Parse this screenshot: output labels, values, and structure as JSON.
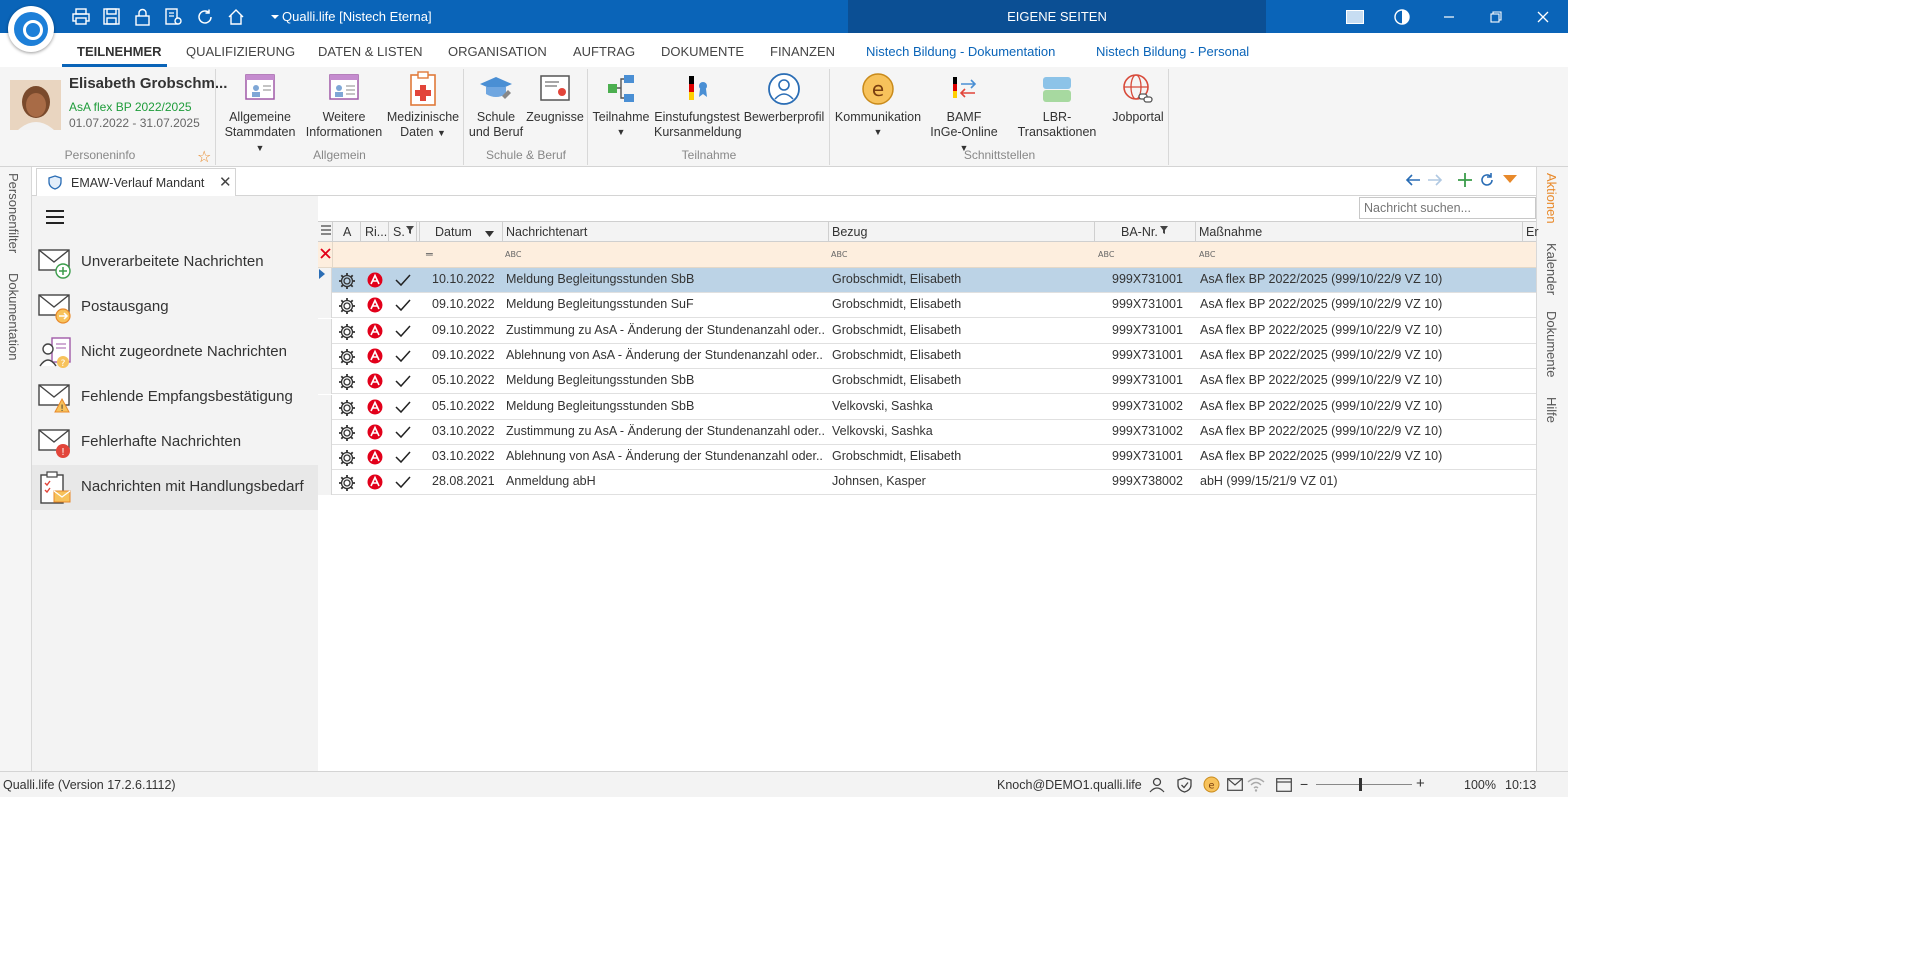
{
  "app": {
    "title": "Qualli.life [Nistech Eterna]",
    "eigene_seiten": "EIGENE SEITEN"
  },
  "tabs": [
    {
      "label": "TEILNEHMER"
    },
    {
      "label": "QUALIFIZIERUNG"
    },
    {
      "label": "DATEN & LISTEN"
    },
    {
      "label": "ORGANISATION"
    },
    {
      "label": "AUFTRAG"
    },
    {
      "label": "DOKUMENTE"
    },
    {
      "label": "FINANZEN"
    },
    {
      "label": "Nistech Bildung - Dokumentation"
    },
    {
      "label": "Nistech Bildung - Personal"
    }
  ],
  "person": {
    "name": "Elisabeth Grobschm...",
    "course": "AsA flex BP 2022/2025",
    "dates": "01.07.2022 - 31.07.2025",
    "group_label": "Personeninfo"
  },
  "ribbon": {
    "allgemeine_1": "Allgemeine",
    "allgemeine_2": "Stammdaten",
    "weitere_1": "Weitere",
    "weitere_2": "Informationen",
    "medizin_1": "Medizinische",
    "medizin_2": "Daten",
    "allgemein_label": "Allgemein",
    "schule_1": "Schule",
    "schule_2": "und Beruf",
    "zeugnisse": "Zeugnisse",
    "schule_label": "Schule & Beruf",
    "teilnahme": "Teilnahme",
    "einstufung_1": "Einstufungstest",
    "einstufung_2": "Kursanmeldung",
    "bewerberprofil": "Bewerberprofil",
    "teilnahme_label": "Teilnahme",
    "kommunikation": "Kommunikation",
    "bamf_1": "BAMF",
    "bamf_2": "InGe-Online",
    "lbr": "LBR-Transaktionen",
    "jobportal": "Jobportal",
    "schnittstellen_label": "Schnittstellen"
  },
  "left_strip": {
    "personenfilter": "Personenfilter",
    "dokumentation": "Dokumentation"
  },
  "right_strip": {
    "aktionen": "Aktionen",
    "kalender": "Kalender",
    "dokumente": "Dokumente",
    "hilfe": "Hilfe"
  },
  "doc_tab": {
    "label": "EMAW-Verlauf Mandant"
  },
  "nav": {
    "items": [
      {
        "label": "Unverarbeitete Nachrichten"
      },
      {
        "label": "Postausgang"
      },
      {
        "label": "Nicht zugeordnete Nachrichten"
      },
      {
        "label": "Fehlende Empfangsbestätigung"
      },
      {
        "label": "Fehlerhafte Nachrichten"
      },
      {
        "label": "Nachrichten mit Handlungsbedarf"
      }
    ]
  },
  "search": {
    "placeholder": "Nachricht suchen..."
  },
  "grid": {
    "headers": {
      "a": "A",
      "ri": "Ri...",
      "s": "S.",
      "datum": "Datum",
      "nachrichtenart": "Nachrichtenart",
      "bezug": "Bezug",
      "ba_nr": "BA-Nr.",
      "massnahme": "Maßnahme",
      "e": "Er"
    },
    "rows": [
      {
        "datum": "10.10.2022",
        "art": "Meldung Begleitungsstunden SbB",
        "bezug": "Grobschmidt, Elisabeth",
        "ba": "999X731001",
        "massnahme": "AsA flex BP 2022/2025 (999/10/22/9 VZ 10)"
      },
      {
        "datum": "09.10.2022",
        "art": "Meldung Begleitungsstunden SuF",
        "bezug": "Grobschmidt, Elisabeth",
        "ba": "999X731001",
        "massnahme": "AsA flex BP 2022/2025 (999/10/22/9 VZ 10)"
      },
      {
        "datum": "09.10.2022",
        "art": "Zustimmung zu AsA - Änderung der Stundenanzahl oder...",
        "bezug": "Grobschmidt, Elisabeth",
        "ba": "999X731001",
        "massnahme": "AsA flex BP 2022/2025 (999/10/22/9 VZ 10)"
      },
      {
        "datum": "09.10.2022",
        "art": "Ablehnung von AsA - Änderung der Stundenanzahl oder...",
        "bezug": "Grobschmidt, Elisabeth",
        "ba": "999X731001",
        "massnahme": "AsA flex BP 2022/2025 (999/10/22/9 VZ 10)"
      },
      {
        "datum": "05.10.2022",
        "art": "Meldung Begleitungsstunden SbB",
        "bezug": "Grobschmidt, Elisabeth",
        "ba": "999X731001",
        "massnahme": "AsA flex BP 2022/2025 (999/10/22/9 VZ 10)"
      },
      {
        "datum": "05.10.2022",
        "art": "Meldung Begleitungsstunden SbB",
        "bezug": "Velkovski, Sashka",
        "ba": "999X731002",
        "massnahme": "AsA flex BP 2022/2025 (999/10/22/9 VZ 10)"
      },
      {
        "datum": "03.10.2022",
        "art": "Zustimmung zu AsA - Änderung der Stundenanzahl oder...",
        "bezug": "Velkovski, Sashka",
        "ba": "999X731002",
        "massnahme": "AsA flex BP 2022/2025 (999/10/22/9 VZ 10)"
      },
      {
        "datum": "03.10.2022",
        "art": "Ablehnung von AsA - Änderung der Stundenanzahl oder...",
        "bezug": "Grobschmidt, Elisabeth",
        "ba": "999X731001",
        "massnahme": "AsA flex BP 2022/2025 (999/10/22/9 VZ 10)"
      },
      {
        "datum": "28.08.2021",
        "art": "Anmeldung abH",
        "bezug": "Johnsen, Kasper",
        "ba": "999X738002",
        "massnahme": "abH (999/15/21/9 VZ 01)"
      }
    ]
  },
  "status": {
    "version": "Qualli.life (Version 17.2.6.1112)",
    "user": "Knoch@DEMO1.qualli.life",
    "zoom": "100%",
    "time": "10:13"
  },
  "colors": {
    "brand_blue": "#0a64b8",
    "selected_row": "#bcd3e6",
    "filter_row": "#fdeede",
    "status_green": "#1e9c3a",
    "accent_orange": "#e8892a",
    "agentur_red": "#e2001a"
  }
}
